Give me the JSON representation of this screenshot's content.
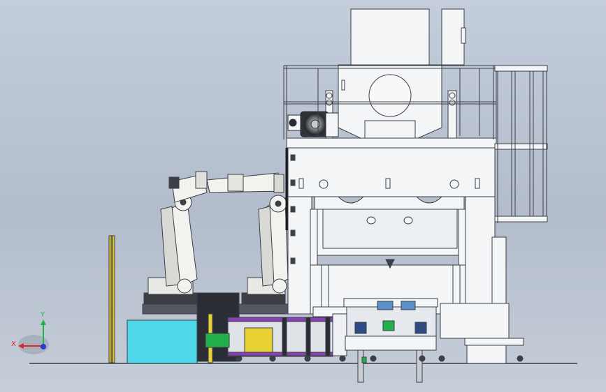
{
  "viewport": {
    "background": [
      "#c4cddb",
      "#b3bccb",
      "#c6ced9"
    ]
  },
  "axis_triad": {
    "x_label": "X",
    "y_label": "Y",
    "x_color": "#e0262b",
    "y_color": "#20b34a",
    "z_color": "#2a3ad6"
  },
  "colors": {
    "press_frame": "#f4f5f6",
    "outline": "#3a3f48",
    "robot_body": "#f2f2ee",
    "robot_base": "#3c3e44",
    "cyan_cabinet": "#4ed7e8",
    "yellow_post": "#e8d233",
    "purple_rail": "#8a3fb3",
    "dark_box": "#2a2d33"
  },
  "scene_objects": [
    "press-machine",
    "motor",
    "guard-railing",
    "side-ladder",
    "robot-arm-left",
    "robot-arm-right",
    "safety-light-post",
    "electrical-cabinet",
    "feeding-conveyor",
    "die-cart"
  ]
}
